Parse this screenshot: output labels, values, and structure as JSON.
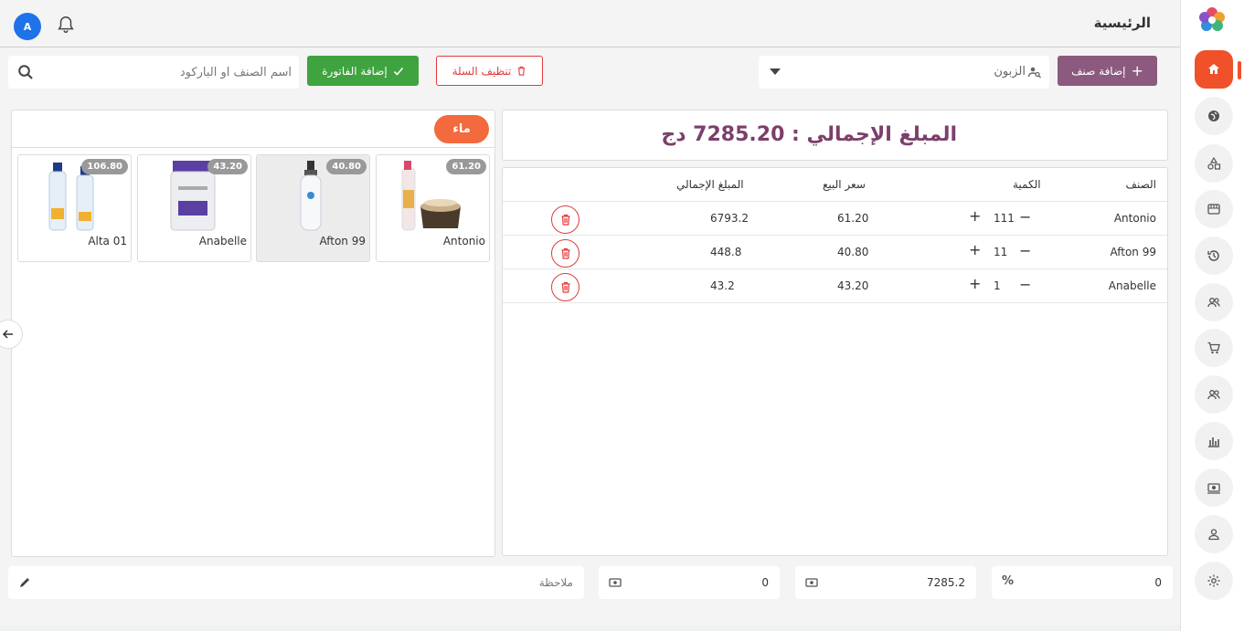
{
  "header": {
    "page_title": "الرئيسية",
    "avatar_initial": "A"
  },
  "toolbar": {
    "add_item_label": "إضافة صنف",
    "customer_placeholder": "الزبون",
    "clear_cart_label": "تنظيف السلة",
    "add_invoice_label": "إضافة الفاتورة",
    "search_placeholder": "اسم الصنف او الباركود"
  },
  "cart": {
    "total_text": "المبلغ الإجمالي : 7285.20 دج",
    "columns": {
      "name": "الصنف",
      "quantity": "الكمية",
      "sale_price": "سعر البيع",
      "total": "المبلغ الإجمالي"
    },
    "rows": [
      {
        "name": "Antonio",
        "qty": "111",
        "price": "61.20",
        "total": "6793.2"
      },
      {
        "name": "Afton 99",
        "qty": "11",
        "price": "40.80",
        "total": "448.8"
      },
      {
        "name": "Anabelle",
        "qty": "1",
        "price": "43.20",
        "total": "43.2"
      }
    ]
  },
  "products": {
    "category": "ماء",
    "items": [
      {
        "name": "Antonio",
        "price": "61.20"
      },
      {
        "name": "Afton 99",
        "price": "40.80"
      },
      {
        "name": "Anabelle",
        "price": "43.20"
      },
      {
        "name": "Alta 01",
        "price": "106.80"
      }
    ]
  },
  "footer": {
    "discount": "0",
    "amount": "7285.2",
    "paid": "0",
    "note_placeholder": "ملاحظة"
  },
  "colors": {
    "accent": "#f0502a",
    "brand": "#8b5a7e",
    "success": "#3fa33f",
    "danger": "#e23a3a"
  }
}
